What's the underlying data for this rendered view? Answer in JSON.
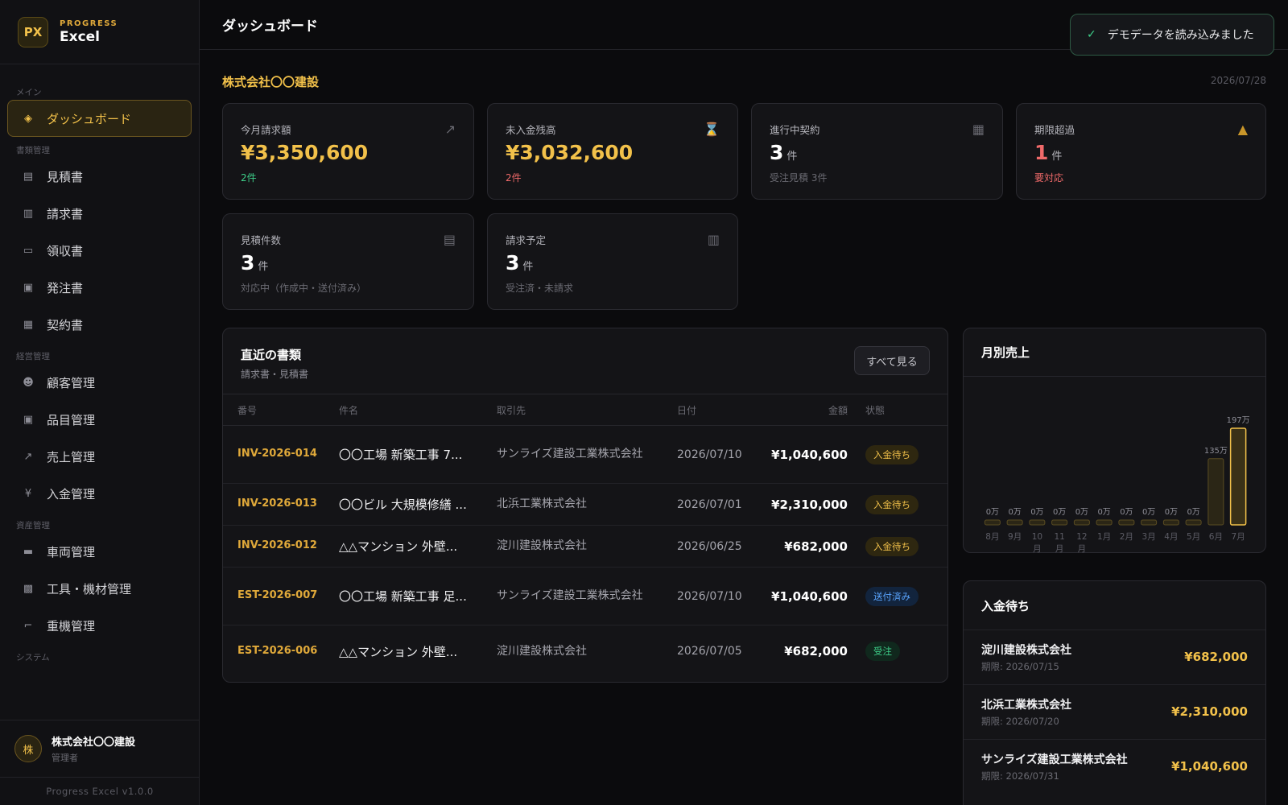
{
  "brand": {
    "logo": "PX",
    "sub": "PROGRESS",
    "name": "Excel"
  },
  "sidebar": {
    "sections": [
      {
        "label": "メイン",
        "items": [
          {
            "label": "ダッシュボード",
            "icon": "◈",
            "active": true
          }
        ]
      },
      {
        "label": "書類管理",
        "items": [
          {
            "label": "見積書",
            "icon": "▤"
          },
          {
            "label": "請求書",
            "icon": "▥"
          },
          {
            "label": "領収書",
            "icon": "▭"
          },
          {
            "label": "発注書",
            "icon": "▣"
          },
          {
            "label": "契約書",
            "icon": "▦"
          }
        ]
      },
      {
        "label": "経営管理",
        "items": [
          {
            "label": "顧客管理",
            "icon": "☻"
          },
          {
            "label": "品目管理",
            "icon": "▣"
          },
          {
            "label": "売上管理",
            "icon": "↗"
          },
          {
            "label": "入金管理",
            "icon": "¥"
          }
        ]
      },
      {
        "label": "資産管理",
        "items": [
          {
            "label": "車両管理",
            "icon": "▬"
          },
          {
            "label": "工具・機材管理",
            "icon": "▩"
          },
          {
            "label": "重機管理",
            "icon": "⌐"
          }
        ]
      },
      {
        "label": "システム",
        "items": []
      }
    ]
  },
  "user": {
    "avatar": "株",
    "name": "株式会社〇〇建設",
    "role": "管理者"
  },
  "version": "Progress Excel v1.0.0",
  "header": {
    "title": "ダッシュボード"
  },
  "toast": {
    "icon": "✓",
    "message": "デモデータを読み込みました"
  },
  "company": "株式会社〇〇建設",
  "date": "2026/07/28",
  "stats": [
    {
      "label": "今月請求額",
      "value": "¥3,350,600",
      "unit": "",
      "sub": "2件",
      "icon": "↗"
    },
    {
      "label": "未入金残高",
      "value": "¥3,032,600",
      "unit": "",
      "sub": "2件",
      "icon": "⌛"
    },
    {
      "label": "進行中契約",
      "value": "3",
      "unit": "件",
      "sub": "受注見積 3件",
      "icon": "▦"
    },
    {
      "label": "期限超過",
      "value": "1",
      "unit": "件",
      "sub": "要対応",
      "icon": "▲"
    },
    {
      "label": "見積件数",
      "value": "3",
      "unit": "件",
      "sub": "対応中（作成中・送付済み）",
      "icon": "▤"
    },
    {
      "label": "請求予定",
      "value": "3",
      "unit": "件",
      "sub": "受注済・未請求",
      "icon": "▥"
    }
  ],
  "recent": {
    "title": "直近の書類",
    "subtitle": "請求書・見積書",
    "view_all": "すべて見る",
    "columns": [
      "番号",
      "件名",
      "取引先",
      "日付",
      "金額",
      "状態"
    ],
    "rows": [
      {
        "no": "INV-2026-014",
        "subject": "〇〇工場 新築工事 7...",
        "client": "サンライズ建設工業株式会社",
        "date": "2026/07/10",
        "amount": "¥1,040,600",
        "status": "入金待ち",
        "status_color": "yellow"
      },
      {
        "no": "INV-2026-013",
        "subject": "〇〇ビル 大規模修繕 ...",
        "client": "北浜工業株式会社",
        "date": "2026/07/01",
        "amount": "¥2,310,000",
        "status": "入金待ち",
        "status_color": "yellow"
      },
      {
        "no": "INV-2026-012",
        "subject": "△△マンション 外壁...",
        "client": "淀川建設株式会社",
        "date": "2026/06/25",
        "amount": "¥682,000",
        "status": "入金待ち",
        "status_color": "yellow"
      },
      {
        "no": "EST-2026-007",
        "subject": "〇〇工場 新築工事 足...",
        "client": "サンライズ建設工業株式会社",
        "date": "2026/07/10",
        "amount": "¥1,040,600",
        "status": "送付済み",
        "status_color": "blue"
      },
      {
        "no": "EST-2026-006",
        "subject": "△△マンション 外壁...",
        "client": "淀川建設株式会社",
        "date": "2026/07/05",
        "amount": "¥682,000",
        "status": "受注",
        "status_color": "green"
      }
    ]
  },
  "chart_data": {
    "type": "bar",
    "title": "月別売上",
    "categories": [
      "8月",
      "9月",
      "10月",
      "11月",
      "12月",
      "1月",
      "2月",
      "3月",
      "4月",
      "5月",
      "6月",
      "7月"
    ],
    "values": [
      0,
      0,
      0,
      0,
      0,
      0,
      0,
      0,
      0,
      0,
      135,
      197
    ],
    "value_labels": [
      "0万",
      "0万",
      "0万",
      "0万",
      "0万",
      "0万",
      "0万",
      "0万",
      "0万",
      "0万",
      "135万",
      "197万"
    ],
    "unit": "万",
    "ylim": [
      0,
      197
    ],
    "grid": false,
    "highlight_index": 11,
    "colors": {
      "bar": "#2b2616",
      "bar_border": "#5a4c22",
      "highlight": "#3a3117",
      "highlight_border": "#f2c14a"
    }
  },
  "pending": {
    "title": "入金待ち",
    "items": [
      {
        "name": "淀川建設株式会社",
        "due": "期限: 2026/07/15",
        "amount": "¥682,000"
      },
      {
        "name": "北浜工業株式会社",
        "due": "期限: 2026/07/20",
        "amount": "¥2,310,000"
      },
      {
        "name": "サンライズ建設工業株式会社",
        "due": "期限: 2026/07/31",
        "amount": "¥1,040,600"
      }
    ]
  }
}
